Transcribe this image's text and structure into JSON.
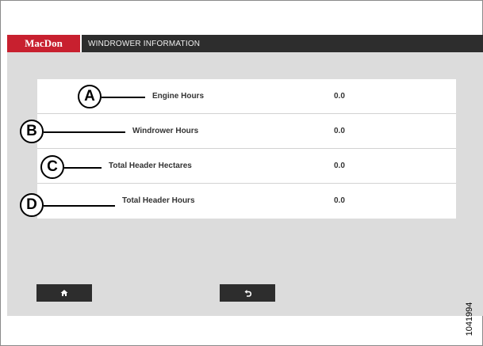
{
  "titlebar": {
    "brand": "MacDon",
    "title": "WINDROWER INFORMATION"
  },
  "rows": [
    {
      "callout": "A",
      "label": "Engine Hours",
      "value": "0.0"
    },
    {
      "callout": "B",
      "label": "Windrower Hours",
      "value": "0.0"
    },
    {
      "callout": "C",
      "label": "Total Header Hectares",
      "value": "0.0"
    },
    {
      "callout": "D",
      "label": "Total Header Hours",
      "value": "0.0"
    }
  ],
  "buttons": {
    "home_icon": "home-icon",
    "back_icon": "back-arrow-icon"
  },
  "colors": {
    "brand_red": "#c8202f",
    "bar_dark": "#2d2d2d",
    "screen_bg": "#dcdcdc",
    "panel_bg": "#ffffff"
  },
  "figure_id": "1041994"
}
